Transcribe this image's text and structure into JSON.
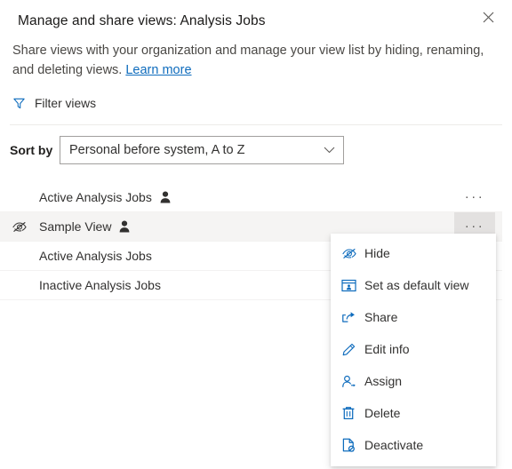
{
  "header": {
    "title": "Manage and share views: Analysis Jobs",
    "close_icon": "close-icon"
  },
  "description": {
    "text": "Share views with your organization and manage your view list by hiding, renaming, and deleting views.",
    "link_label": "Learn more"
  },
  "filter": {
    "label": "Filter views",
    "icon": "filter-funnel-icon",
    "icon_color": "#0f6cbd"
  },
  "sort": {
    "label": "Sort by",
    "selected_value": "Personal before system, A to Z",
    "chevron_icon": "chevron-down-icon"
  },
  "view_list": {
    "rows": [
      {
        "name": "Active Analysis Jobs",
        "has_person_icon": true,
        "hidden": false,
        "selected": false,
        "more_label": "···"
      },
      {
        "name": "Sample View",
        "has_person_icon": true,
        "hidden": true,
        "selected": true,
        "more_label": "···"
      },
      {
        "name": "Active Analysis Jobs",
        "has_person_icon": false,
        "hidden": false,
        "selected": false,
        "more_label": "···"
      },
      {
        "name": "Inactive Analysis Jobs",
        "has_person_icon": false,
        "hidden": false,
        "selected": false,
        "more_label": "···"
      }
    ]
  },
  "context_menu": {
    "items": [
      {
        "label": "Hide",
        "icon": "hide-eye-slash-icon"
      },
      {
        "label": "Set as default view",
        "icon": "set-default-view-icon"
      },
      {
        "label": "Share",
        "icon": "share-icon"
      },
      {
        "label": "Edit info",
        "icon": "edit-pencil-icon"
      },
      {
        "label": "Assign",
        "icon": "assign-person-icon"
      },
      {
        "label": "Delete",
        "icon": "delete-trash-icon"
      },
      {
        "label": "Deactivate",
        "icon": "deactivate-document-icon"
      }
    ]
  },
  "colors": {
    "accent": "#0f6cbd",
    "link": "#0f6cbd",
    "selected_row_bg": "#f5f4f3",
    "more_button_bg": "#e3e1e0"
  }
}
